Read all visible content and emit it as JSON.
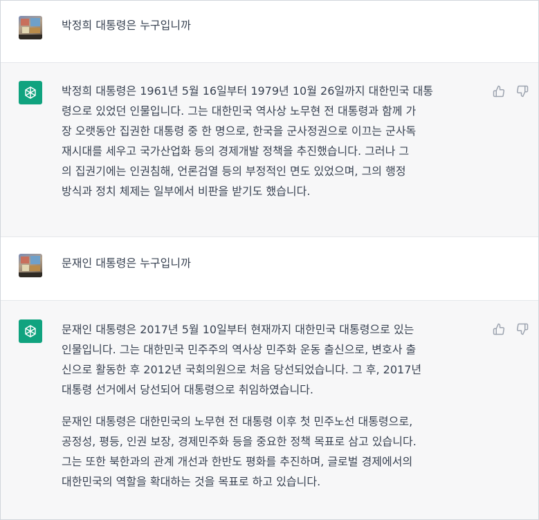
{
  "conversation": [
    {
      "role": "user",
      "avatar": "user-avatar",
      "text": "박정희 대통령은 누구입니까"
    },
    {
      "role": "assistant",
      "avatar": "chatgpt-logo-icon",
      "lines": [
        "박정희 대통령은 1961년 5월 16일부터 1979년 10월 26일까지 대한민국 대통",
        "령으로 있었던 인물입니다. 그는 대한민국 역사상 노무현 전 대통령과 함께 가",
        "장 오랫동안 집권한 대통령 중 한 명으로, 한국을 군사정권으로 이끄는 군사독",
        "재시대를 세우고 국가산업화 등의 경제개발 정책을 추진했습니다. 그러나 그",
        "의 집권기에는 인권침해, 언론검열 등의 부정적인 면도 있었으며, 그의 행정",
        "방식과 정치 체제는 일부에서 비판을 받기도 했습니다."
      ]
    },
    {
      "role": "user",
      "avatar": "user-avatar",
      "text": "문재인 대통령은 누구입니까"
    },
    {
      "role": "assistant",
      "avatar": "chatgpt-logo-icon",
      "paragraph1": [
        "문재인 대통령은 2017년 5월 10일부터 현재까지 대한민국 대통령으로 있는",
        "인물입니다. 그는 대한민국 민주주의 역사상 민주화 운동 출신으로, 변호사 출",
        "신으로 활동한 후 2012년 국회의원으로 처음 당선되었습니다. 그 후, 2017년",
        "대통령 선거에서 당선되어 대통령으로 취임하였습니다."
      ],
      "paragraph2": [
        "문재인 대통령은 대한민국의 노무현 전 대통령 이후 첫 민주노선 대통령으로,",
        "공정성, 평등, 인권 보장, 경제민주화 등을 중요한 정책 목표로 삼고 있습니다.",
        "그는 또한 북한과의 관계 개선과 한반도 평화를 추진하며, 글로벌 경제에서의",
        "대한민국의 역할을 확대하는 것을 목표로 하고 있습니다."
      ]
    }
  ],
  "icons": {
    "thumbs_up": "thumbs-up-icon",
    "thumbs_down": "thumbs-down-icon"
  },
  "colors": {
    "assistant_bg": "#f7f7f8",
    "user_bg": "#ffffff",
    "logo_green": "#10a37f",
    "text": "#374151"
  }
}
